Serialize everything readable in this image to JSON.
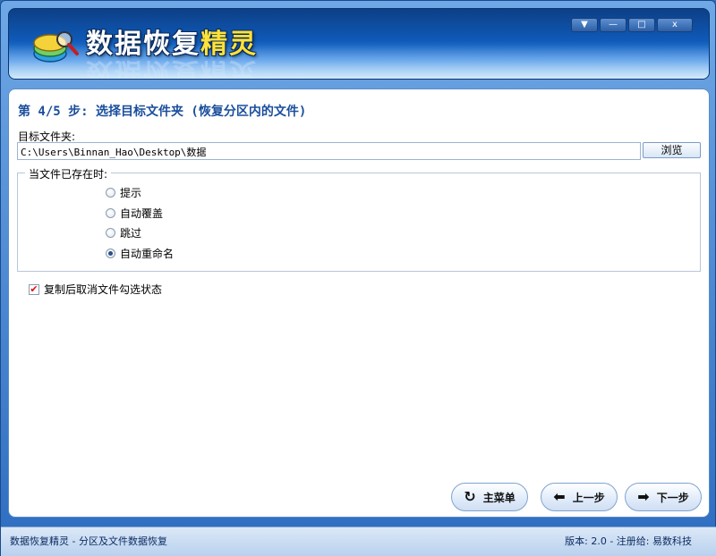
{
  "window": {
    "title": "数据恢复精灵",
    "title_main": "数据恢复",
    "title_accent": "精灵",
    "controls": {
      "menu": "▼",
      "minimize": "—",
      "maximize": "□",
      "close": "x"
    }
  },
  "step": {
    "title": "第 4/5 步: 选择目标文件夹 (恢复分区内的文件)"
  },
  "target_folder": {
    "label": "目标文件夹:",
    "path": "C:\\Users\\Binnan_Hao\\Desktop\\数据",
    "browse_label": "浏览"
  },
  "file_exists": {
    "legend": "当文件已存在时:",
    "options": [
      {
        "label": "提示",
        "selected": false
      },
      {
        "label": "自动覆盖",
        "selected": false
      },
      {
        "label": "跳过",
        "selected": false
      },
      {
        "label": "自动重命名",
        "selected": true
      }
    ]
  },
  "uncheck_after_copy": {
    "label": "复制后取消文件勾选状态",
    "checked": true
  },
  "nav": {
    "main_menu": "主菜单",
    "prev": "上一步",
    "next": "下一步"
  },
  "statusbar": {
    "left": "数据恢复精灵 - 分区及文件数据恢复",
    "right": "版本: 2.0 - 注册给: 易数科技"
  }
}
